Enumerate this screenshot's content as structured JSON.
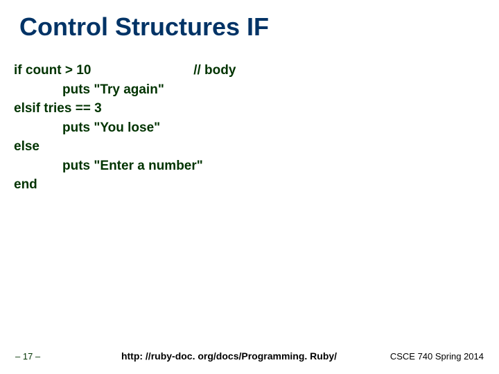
{
  "title": "Control Structures IF",
  "code": {
    "line1_left": "if count > 10",
    "line1_right": "// body",
    "line2": "puts \"Try again\"",
    "line3": "elsif tries == 3",
    "line4": "puts \"You lose\"",
    "line5": "else",
    "line6": "puts \"Enter a number\"",
    "line7": "end"
  },
  "footer": {
    "left": "– 17 –",
    "center": "http: //ruby-doc. org/docs/Programming. Ruby/",
    "right": "CSCE 740 Spring 2014"
  }
}
